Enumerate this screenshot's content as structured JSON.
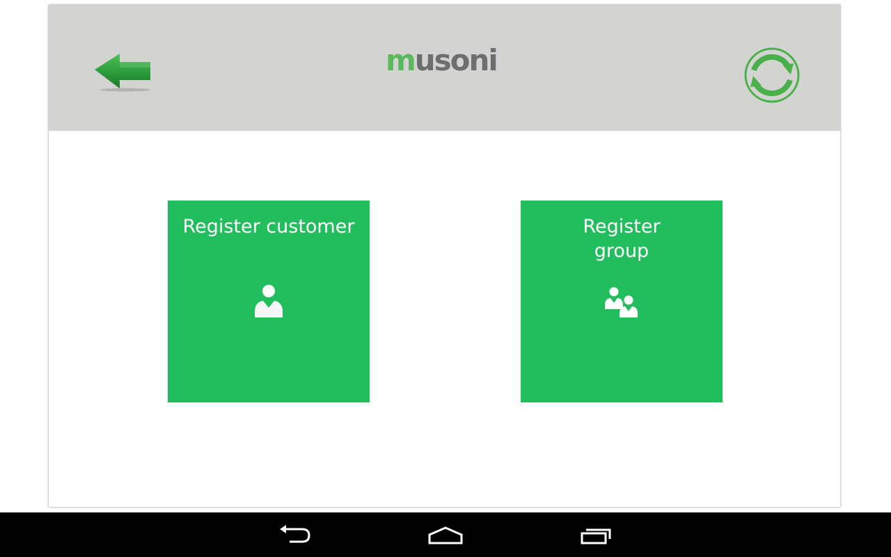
{
  "header": {
    "back_icon": "back-arrow-icon",
    "logo": {
      "first_letter": "m",
      "rest": "usoni"
    },
    "refresh_icon": "refresh-icon"
  },
  "tiles": [
    {
      "label": "Register customer",
      "icon": "person-icon"
    },
    {
      "label": "Register group",
      "icon": "people-icon"
    }
  ],
  "nav_bar": {
    "back_icon": "nav-back-icon",
    "home_icon": "nav-home-icon",
    "recents_icon": "nav-recents-icon"
  },
  "colors": {
    "header_bg": "#d3d4d2",
    "tile_green": "#22bd5d",
    "logo_green": "#5cb85c",
    "logo_gray": "#6d6e70",
    "arrow_green": "#2b9a3b"
  }
}
